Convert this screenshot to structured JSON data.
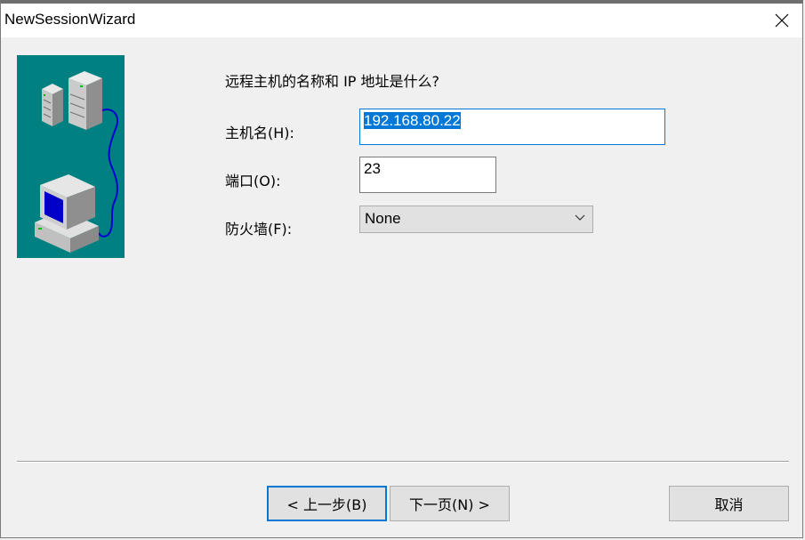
{
  "window": {
    "title": "NewSessionWizard",
    "close_icon": "close-icon"
  },
  "illustration": {
    "icons": [
      "server-icon",
      "network-cable-icon",
      "computer-icon"
    ],
    "background_color": "#008080"
  },
  "form": {
    "question": "远程主机的名称和 IP 地址是什么?",
    "hostname": {
      "label": "主机名(H):",
      "value": "192.168.80.22",
      "selected": true
    },
    "port": {
      "label": "端口(O):",
      "value": "23"
    },
    "firewall": {
      "label": "防火墙(F):",
      "selected": "None",
      "icon": "chevron-down-icon"
    }
  },
  "buttons": {
    "back": "< 上一步(B)",
    "next": "下一页(N) >",
    "cancel": "取消"
  },
  "colors": {
    "accent": "#0078d7",
    "window_bg": "#f0f0f0",
    "button_bg": "#e1e1e1"
  }
}
